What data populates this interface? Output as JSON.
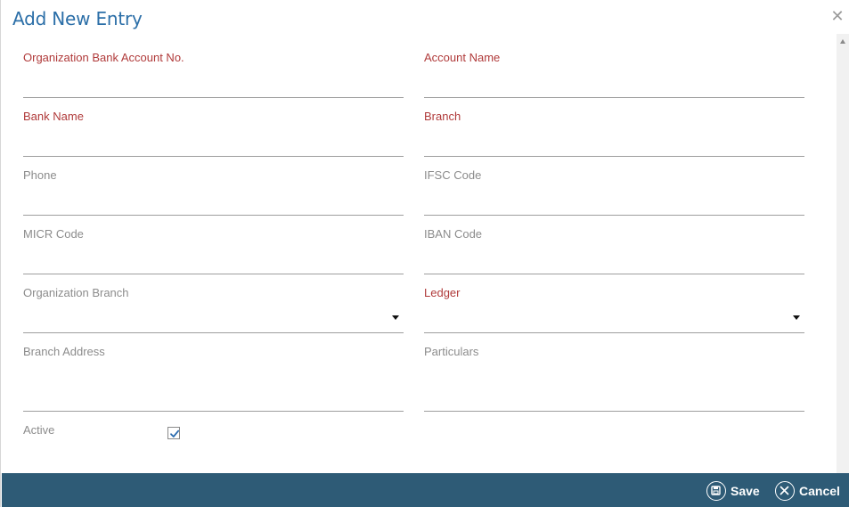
{
  "dialog": {
    "title": "Add New Entry",
    "close_icon": "close-icon"
  },
  "fields": {
    "org_bank_account_no": {
      "label": "Organization Bank Account No.",
      "value": "",
      "required": true
    },
    "account_name": {
      "label": "Account Name",
      "value": "",
      "required": true
    },
    "bank_name": {
      "label": "Bank Name",
      "value": "",
      "required": true
    },
    "branch": {
      "label": "Branch",
      "value": "",
      "required": true
    },
    "phone": {
      "label": "Phone",
      "value": "",
      "required": false
    },
    "ifsc_code": {
      "label": "IFSC Code",
      "value": "",
      "required": false
    },
    "micr_code": {
      "label": "MICR Code",
      "value": "",
      "required": false
    },
    "iban_code": {
      "label": "IBAN Code",
      "value": "",
      "required": false
    },
    "organization_branch": {
      "label": "Organization Branch",
      "value": "",
      "required": false
    },
    "ledger": {
      "label": "Ledger",
      "value": "",
      "required": true
    },
    "branch_address": {
      "label": "Branch Address",
      "value": "",
      "required": false
    },
    "particulars": {
      "label": "Particulars",
      "value": "",
      "required": false
    }
  },
  "active": {
    "label": "Active",
    "checked": true
  },
  "footer": {
    "save_label": "Save",
    "cancel_label": "Cancel"
  },
  "colors": {
    "title": "#2c6fa8",
    "required_label": "#b03a3a",
    "optional_label": "#8c8c8c",
    "footer_bg": "#2e5b76"
  }
}
